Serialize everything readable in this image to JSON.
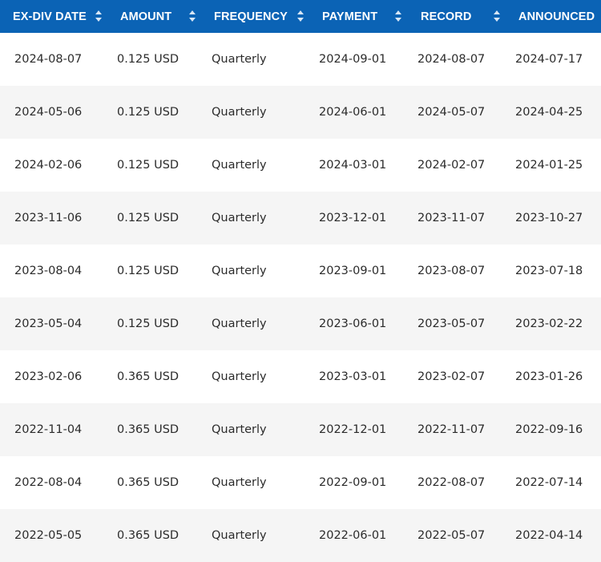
{
  "columns": [
    {
      "label": "EX-DIV DATE",
      "icon": "sort-icon"
    },
    {
      "label": "AMOUNT",
      "icon": "sort-icon"
    },
    {
      "label": "FREQUENCY",
      "icon": "sort-icon"
    },
    {
      "label": "PAYMENT",
      "icon": "sort-icon"
    },
    {
      "label": "RECORD",
      "icon": "sort-icon"
    },
    {
      "label": "ANNOUNCED",
      "icon": ""
    }
  ],
  "rows": [
    [
      "2024-08-07",
      "0.125 USD",
      "Quarterly",
      "2024-09-01",
      "2024-08-07",
      "2024-07-17"
    ],
    [
      "2024-05-06",
      "0.125 USD",
      "Quarterly",
      "2024-06-01",
      "2024-05-07",
      "2024-04-25"
    ],
    [
      "2024-02-06",
      "0.125 USD",
      "Quarterly",
      "2024-03-01",
      "2024-02-07",
      "2024-01-25"
    ],
    [
      "2023-11-06",
      "0.125 USD",
      "Quarterly",
      "2023-12-01",
      "2023-11-07",
      "2023-10-27"
    ],
    [
      "2023-08-04",
      "0.125 USD",
      "Quarterly",
      "2023-09-01",
      "2023-08-07",
      "2023-07-18"
    ],
    [
      "2023-05-04",
      "0.125 USD",
      "Quarterly",
      "2023-06-01",
      "2023-05-07",
      "2023-02-22"
    ],
    [
      "2023-02-06",
      "0.365 USD",
      "Quarterly",
      "2023-03-01",
      "2023-02-07",
      "2023-01-26"
    ],
    [
      "2022-11-04",
      "0.365 USD",
      "Quarterly",
      "2022-12-01",
      "2022-11-07",
      "2022-09-16"
    ],
    [
      "2022-08-04",
      "0.365 USD",
      "Quarterly",
      "2022-09-01",
      "2022-08-07",
      "2022-07-14"
    ],
    [
      "2022-05-05",
      "0.365 USD",
      "Quarterly",
      "2022-06-01",
      "2022-05-07",
      "2022-04-14"
    ]
  ],
  "colors": {
    "header_bg": "#0b63b5",
    "header_text": "#ffffff",
    "row_alt_bg": "#f5f5f5",
    "sort_icon": "#d7e6f5"
  }
}
